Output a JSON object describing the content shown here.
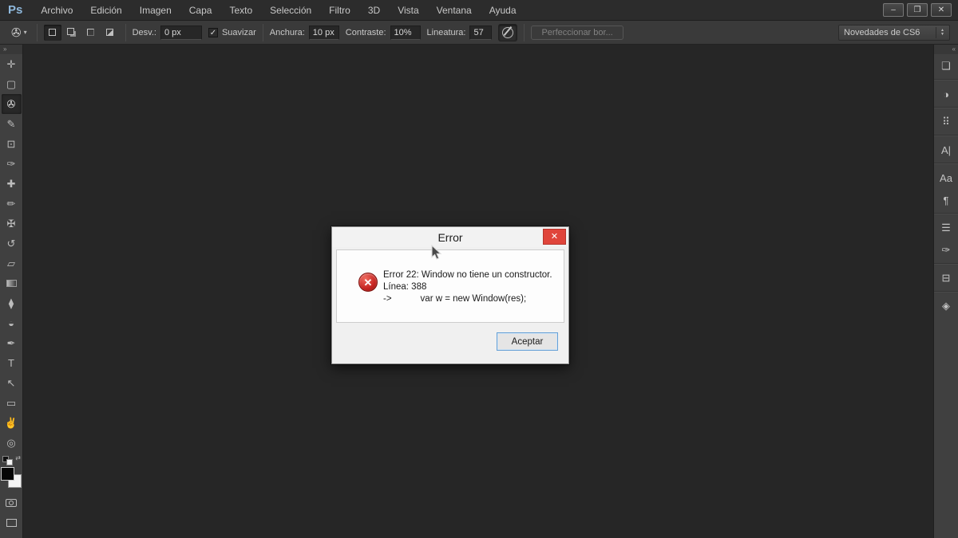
{
  "menubar": {
    "logo": "Ps",
    "items": [
      {
        "name": "archivo",
        "label": "Archivo"
      },
      {
        "name": "edicion",
        "label": "Edición"
      },
      {
        "name": "imagen",
        "label": "Imagen"
      },
      {
        "name": "capa",
        "label": "Capa"
      },
      {
        "name": "texto",
        "label": "Texto"
      },
      {
        "name": "seleccion",
        "label": "Selección"
      },
      {
        "name": "filtro",
        "label": "Filtro"
      },
      {
        "name": "3d",
        "label": "3D"
      },
      {
        "name": "vista",
        "label": "Vista"
      },
      {
        "name": "ventana",
        "label": "Ventana"
      },
      {
        "name": "ayuda",
        "label": "Ayuda"
      }
    ],
    "window_controls": [
      {
        "name": "minimize",
        "glyph": "–"
      },
      {
        "name": "restore",
        "glyph": "❐"
      },
      {
        "name": "close",
        "glyph": "✕"
      }
    ]
  },
  "options_bar": {
    "tool_preset_glyph": "✇",
    "caret": "▾",
    "selection_modes": [
      {
        "name": "new-selection",
        "active": true
      },
      {
        "name": "add-to-selection",
        "active": false
      },
      {
        "name": "subtract-from-selection",
        "active": false
      },
      {
        "name": "intersect-selection",
        "active": false
      }
    ],
    "desv_label": "Desv.:",
    "desv_value": "0 px",
    "suavizar_checked": "✓",
    "suavizar_label": "Suavizar",
    "anchura_label": "Anchura:",
    "anchura_value": "10 px",
    "contraste_label": "Contraste:",
    "contraste_value": "10%",
    "lineatura_label": "Lineatura:",
    "lineatura_value": "57",
    "refine_edge_label": "Perfeccionar bor...",
    "workspace_select_value": "Novedades de CS6"
  },
  "toolbar": {
    "collapse_glyph": "»",
    "tools": [
      {
        "name": "move-tool",
        "glyph": "✛"
      },
      {
        "name": "marquee-tool",
        "glyph": "▢"
      },
      {
        "name": "magnetic-lasso-tool",
        "glyph": "✇",
        "selected": true
      },
      {
        "name": "quick-selection-tool",
        "glyph": "✎"
      },
      {
        "name": "crop-tool",
        "glyph": "⊡"
      },
      {
        "name": "eyedropper-tool",
        "glyph": "✑"
      },
      {
        "name": "healing-brush-tool",
        "glyph": "✚"
      },
      {
        "name": "brush-tool",
        "glyph": "✏"
      },
      {
        "name": "clone-stamp-tool",
        "glyph": "✠"
      },
      {
        "name": "history-brush-tool",
        "glyph": "↺"
      },
      {
        "name": "eraser-tool",
        "glyph": "▱"
      },
      {
        "name": "gradient-tool",
        "glyph": "",
        "gradient": true
      },
      {
        "name": "blur-tool",
        "glyph": "⧫"
      },
      {
        "name": "dodge-tool",
        "glyph": "◒"
      },
      {
        "name": "pen-tool",
        "glyph": "✒"
      },
      {
        "name": "type-tool",
        "glyph": "T"
      },
      {
        "name": "path-selection-tool",
        "glyph": "↖"
      },
      {
        "name": "shape-tool",
        "glyph": "▭"
      },
      {
        "name": "hand-tool",
        "glyph": "✌"
      },
      {
        "name": "zoom-tool",
        "glyph": "◎"
      }
    ],
    "swap_arrow": "⇄"
  },
  "right_dock": {
    "collapse_glyph": "«",
    "panels": [
      {
        "name": "layers-panel",
        "glyph": "❏",
        "sep": true
      },
      {
        "name": "adjustments-panel",
        "glyph": "◑",
        "sep": true
      },
      {
        "name": "styles-panel",
        "glyph": "⠿",
        "sep": true
      },
      {
        "name": "character-panel",
        "glyph": "A|",
        "sep": true
      },
      {
        "name": "character-styles-panel",
        "glyph": "Aa",
        "sep": false
      },
      {
        "name": "paragraph-styles-panel",
        "glyph": "¶",
        "sep": true
      },
      {
        "name": "properties-panel",
        "glyph": "☰",
        "sep": false
      },
      {
        "name": "brush-presets-panel",
        "glyph": "✑",
        "sep": true
      },
      {
        "name": "timeline-panel",
        "glyph": "⊟",
        "sep": true
      },
      {
        "name": "3d-panel",
        "glyph": "◈",
        "sep": false
      }
    ]
  },
  "dialog": {
    "title": "Error",
    "close_glyph": "✕",
    "error_icon_glyph": "✕",
    "line1": "Error 22: Window no tiene un constructor.",
    "line2": "Línea: 388",
    "line3_prefix": "->",
    "line3_code": "var w = new Window(res);",
    "ok_label": "Aceptar"
  },
  "colors": {
    "close_button_red": "#e0453b",
    "error_icon_red": "#c62421",
    "focus_border_blue": "#66a0d6",
    "ps_logo_blue": "#8fb9dd",
    "canvas_gray": "#262626"
  }
}
